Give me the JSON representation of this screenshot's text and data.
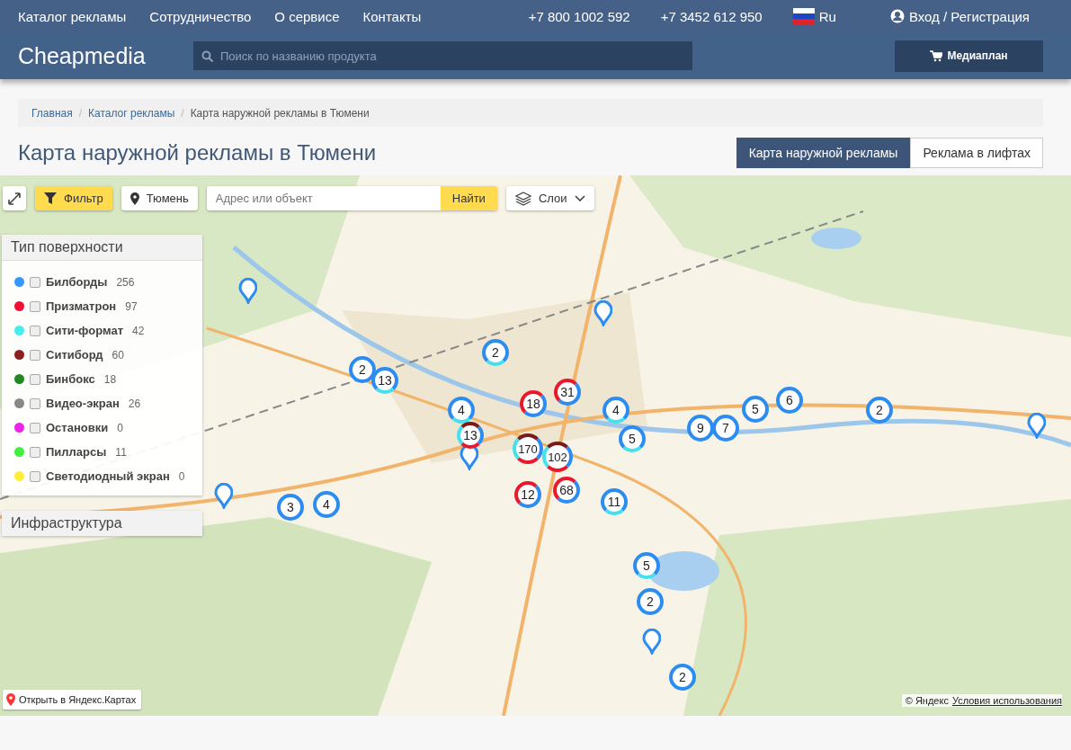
{
  "top_nav": {
    "links": [
      "Каталог рекламы",
      "Сотрудничество",
      "О сервисе",
      "Контакты"
    ],
    "phones": [
      "+7 800 1002 592",
      "+7 3452 612 950"
    ],
    "language": "Ru",
    "login": "Вход / Регистрация"
  },
  "header": {
    "logo": "Cheapmedia",
    "search": {
      "placeholder": "Поиск по названию продукта"
    },
    "mediaplan_button": "Медиаплан"
  },
  "breadcrumbs": [
    "Главная",
    "Каталог рекламы",
    "Карта наружной рекламы в Тюмени"
  ],
  "breadcrumb_separators": [
    "/",
    "/"
  ],
  "page_title": "Карта наружной рекламы в Тюмени",
  "tabs": [
    {
      "label": "Карта наружной рекламы",
      "selected": true
    },
    {
      "label": "Реклама в лифтах",
      "selected": false
    }
  ],
  "map_toolbar": {
    "filter_button": "Фильтр",
    "city_button": "Тюмень",
    "address_field": {
      "placeholder": "Адрес или объект"
    },
    "find_button": "Найти",
    "layers_button": "Слои"
  },
  "filter_panel": {
    "title": "Тип поверхности",
    "items": [
      {
        "label": "Билборды",
        "count": "256",
        "color": "#3399ff",
        "checked": false
      },
      {
        "label": "Призматрон",
        "count": "97",
        "color": "#ee1133",
        "checked": false
      },
      {
        "label": "Сити-формат",
        "count": "42",
        "color": "#44eeee",
        "checked": false
      },
      {
        "label": "Ситиборд",
        "count": "60",
        "color": "#882222",
        "checked": false
      },
      {
        "label": "Бинбокс",
        "count": "18",
        "color": "#228822",
        "checked": false
      },
      {
        "label": "Видео-экран",
        "count": "26",
        "color": "#888888",
        "checked": false
      },
      {
        "label": "Остановки",
        "count": "0",
        "color": "#ee22ee",
        "checked": false
      },
      {
        "label": "Пилларсы",
        "count": "11",
        "color": "#44ee44",
        "checked": false
      },
      {
        "label": "Светодиодный экран",
        "count": "0",
        "color": "#ffee33",
        "checked": false
      }
    ]
  },
  "infrastructure_panel": {
    "title": "Инфраструктура"
  },
  "map": {
    "kind": "picture",
    "clusters": [
      "2",
      "2",
      "13",
      "31",
      "18",
      "4",
      "4",
      "13",
      "5",
      "170",
      "102",
      "9",
      "7",
      "5",
      "6",
      "2",
      "68",
      "12",
      "11",
      "3",
      "4",
      "5",
      "2",
      "2"
    ]
  },
  "map_footer": {
    "open_link": "Открыть в Яндекс.Картах",
    "copyright": "© Яндекс",
    "terms_link": "Условия использования"
  }
}
